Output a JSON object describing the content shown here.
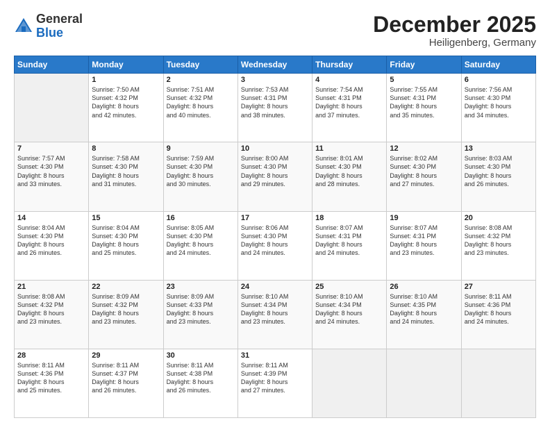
{
  "header": {
    "logo_general": "General",
    "logo_blue": "Blue",
    "title": "December 2025",
    "subtitle": "Heiligenberg, Germany"
  },
  "calendar": {
    "days_of_week": [
      "Sunday",
      "Monday",
      "Tuesday",
      "Wednesday",
      "Thursday",
      "Friday",
      "Saturday"
    ],
    "weeks": [
      [
        {
          "day": "",
          "info": ""
        },
        {
          "day": "1",
          "info": "Sunrise: 7:50 AM\nSunset: 4:32 PM\nDaylight: 8 hours\nand 42 minutes."
        },
        {
          "day": "2",
          "info": "Sunrise: 7:51 AM\nSunset: 4:32 PM\nDaylight: 8 hours\nand 40 minutes."
        },
        {
          "day": "3",
          "info": "Sunrise: 7:53 AM\nSunset: 4:31 PM\nDaylight: 8 hours\nand 38 minutes."
        },
        {
          "day": "4",
          "info": "Sunrise: 7:54 AM\nSunset: 4:31 PM\nDaylight: 8 hours\nand 37 minutes."
        },
        {
          "day": "5",
          "info": "Sunrise: 7:55 AM\nSunset: 4:31 PM\nDaylight: 8 hours\nand 35 minutes."
        },
        {
          "day": "6",
          "info": "Sunrise: 7:56 AM\nSunset: 4:30 PM\nDaylight: 8 hours\nand 34 minutes."
        }
      ],
      [
        {
          "day": "7",
          "info": "Sunrise: 7:57 AM\nSunset: 4:30 PM\nDaylight: 8 hours\nand 33 minutes."
        },
        {
          "day": "8",
          "info": "Sunrise: 7:58 AM\nSunset: 4:30 PM\nDaylight: 8 hours\nand 31 minutes."
        },
        {
          "day": "9",
          "info": "Sunrise: 7:59 AM\nSunset: 4:30 PM\nDaylight: 8 hours\nand 30 minutes."
        },
        {
          "day": "10",
          "info": "Sunrise: 8:00 AM\nSunset: 4:30 PM\nDaylight: 8 hours\nand 29 minutes."
        },
        {
          "day": "11",
          "info": "Sunrise: 8:01 AM\nSunset: 4:30 PM\nDaylight: 8 hours\nand 28 minutes."
        },
        {
          "day": "12",
          "info": "Sunrise: 8:02 AM\nSunset: 4:30 PM\nDaylight: 8 hours\nand 27 minutes."
        },
        {
          "day": "13",
          "info": "Sunrise: 8:03 AM\nSunset: 4:30 PM\nDaylight: 8 hours\nand 26 minutes."
        }
      ],
      [
        {
          "day": "14",
          "info": "Sunrise: 8:04 AM\nSunset: 4:30 PM\nDaylight: 8 hours\nand 26 minutes."
        },
        {
          "day": "15",
          "info": "Sunrise: 8:04 AM\nSunset: 4:30 PM\nDaylight: 8 hours\nand 25 minutes."
        },
        {
          "day": "16",
          "info": "Sunrise: 8:05 AM\nSunset: 4:30 PM\nDaylight: 8 hours\nand 24 minutes."
        },
        {
          "day": "17",
          "info": "Sunrise: 8:06 AM\nSunset: 4:30 PM\nDaylight: 8 hours\nand 24 minutes."
        },
        {
          "day": "18",
          "info": "Sunrise: 8:07 AM\nSunset: 4:31 PM\nDaylight: 8 hours\nand 24 minutes."
        },
        {
          "day": "19",
          "info": "Sunrise: 8:07 AM\nSunset: 4:31 PM\nDaylight: 8 hours\nand 23 minutes."
        },
        {
          "day": "20",
          "info": "Sunrise: 8:08 AM\nSunset: 4:32 PM\nDaylight: 8 hours\nand 23 minutes."
        }
      ],
      [
        {
          "day": "21",
          "info": "Sunrise: 8:08 AM\nSunset: 4:32 PM\nDaylight: 8 hours\nand 23 minutes."
        },
        {
          "day": "22",
          "info": "Sunrise: 8:09 AM\nSunset: 4:32 PM\nDaylight: 8 hours\nand 23 minutes."
        },
        {
          "day": "23",
          "info": "Sunrise: 8:09 AM\nSunset: 4:33 PM\nDaylight: 8 hours\nand 23 minutes."
        },
        {
          "day": "24",
          "info": "Sunrise: 8:10 AM\nSunset: 4:34 PM\nDaylight: 8 hours\nand 23 minutes."
        },
        {
          "day": "25",
          "info": "Sunrise: 8:10 AM\nSunset: 4:34 PM\nDaylight: 8 hours\nand 24 minutes."
        },
        {
          "day": "26",
          "info": "Sunrise: 8:10 AM\nSunset: 4:35 PM\nDaylight: 8 hours\nand 24 minutes."
        },
        {
          "day": "27",
          "info": "Sunrise: 8:11 AM\nSunset: 4:36 PM\nDaylight: 8 hours\nand 24 minutes."
        }
      ],
      [
        {
          "day": "28",
          "info": "Sunrise: 8:11 AM\nSunset: 4:36 PM\nDaylight: 8 hours\nand 25 minutes."
        },
        {
          "day": "29",
          "info": "Sunrise: 8:11 AM\nSunset: 4:37 PM\nDaylight: 8 hours\nand 26 minutes."
        },
        {
          "day": "30",
          "info": "Sunrise: 8:11 AM\nSunset: 4:38 PM\nDaylight: 8 hours\nand 26 minutes."
        },
        {
          "day": "31",
          "info": "Sunrise: 8:11 AM\nSunset: 4:39 PM\nDaylight: 8 hours\nand 27 minutes."
        },
        {
          "day": "",
          "info": ""
        },
        {
          "day": "",
          "info": ""
        },
        {
          "day": "",
          "info": ""
        }
      ]
    ]
  }
}
